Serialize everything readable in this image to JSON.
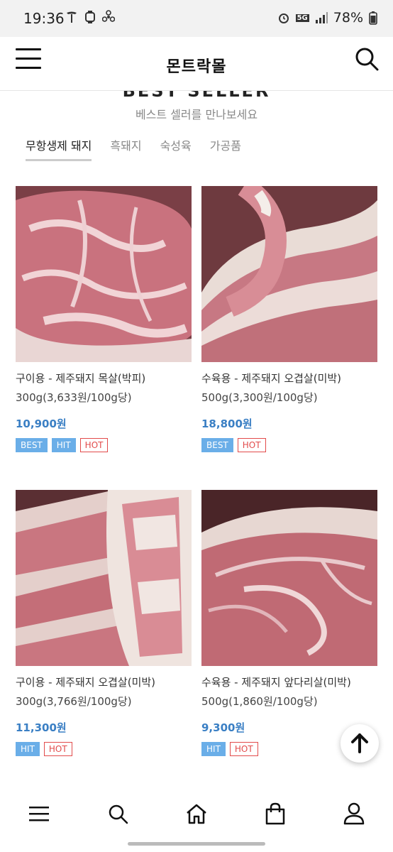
{
  "status": {
    "time": "19:36",
    "battery": "78%",
    "network": "5G"
  },
  "header": {
    "logo": "몬트락몰"
  },
  "section": {
    "title": "BEST SELLER",
    "subtitle": "베스트 셀러를 만나보세요"
  },
  "tabs": [
    {
      "label": "무항생제 돼지",
      "active": true
    },
    {
      "label": "흑돼지",
      "active": false
    },
    {
      "label": "숙성육",
      "active": false
    },
    {
      "label": "가공품",
      "active": false
    }
  ],
  "products": [
    {
      "name": "구이용 - 제주돼지 목살(박피)",
      "unit": "300g(3,633원/100g당)",
      "price": "10,900원",
      "badges": [
        "BEST",
        "HIT",
        "HOT"
      ]
    },
    {
      "name": "수육용 - 제주돼지 오겹살(미박)",
      "unit": "500g(3,300원/100g당)",
      "price": "18,800원",
      "badges": [
        "BEST",
        "HOT"
      ]
    },
    {
      "name": "구이용 - 제주돼지 오겹살(미박)",
      "unit": "300g(3,766원/100g당)",
      "price": "11,300원",
      "badges": [
        "HIT",
        "HOT"
      ]
    },
    {
      "name": "수육용 - 제주돼지 앞다리살(미박)",
      "unit": "500g(1,860원/100g당)",
      "price": "9,300원",
      "badges": [
        "HIT",
        "HOT"
      ]
    }
  ],
  "icons": {
    "menu": "menu-icon",
    "search": "search-icon",
    "to_top": "arrow-up-icon",
    "nav": [
      "menu-icon",
      "search-icon",
      "home-icon",
      "shopping-bag-icon",
      "user-icon"
    ]
  },
  "colors": {
    "price": "#3a7fc4",
    "badge_blue": "#6aaee8",
    "badge_hot": "#e24b4b",
    "meat": "#b46070"
  }
}
